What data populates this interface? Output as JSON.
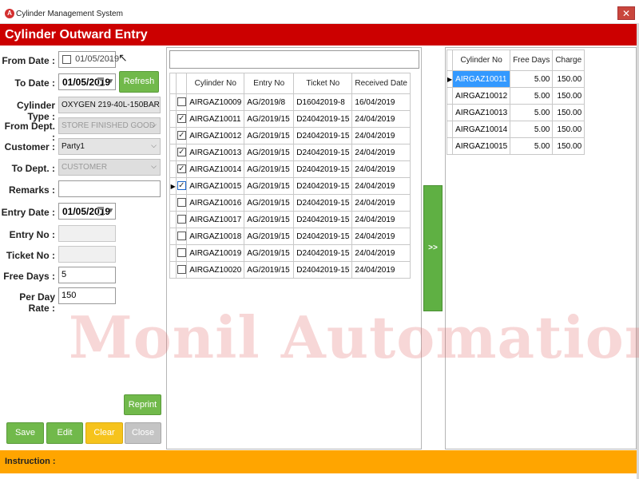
{
  "window": {
    "app_icon": "A",
    "title": "Cylinder Management System",
    "close_symbol": "✕"
  },
  "header": {
    "title": "Cylinder Outward Entry"
  },
  "form": {
    "from_date_label": "From Date :",
    "from_date_value": "01/05/2019",
    "to_date_label": "To Date :",
    "to_date_value": "01/05/2019",
    "refresh_label": "Refresh",
    "cylinder_type_label": "Cylinder Type :",
    "cylinder_type_value": "OXYGEN 219-40L-150BAR",
    "from_dept_label": "From Dept. :",
    "from_dept_value": "STORE FINISHED GOOD",
    "customer_label": "Customer :",
    "customer_value": "Party1",
    "to_dept_label": "To Dept. :",
    "to_dept_value": "CUSTOMER",
    "remarks_label": "Remarks :",
    "remarks_value": "",
    "entry_date_label": "Entry Date :",
    "entry_date_value": "01/05/2019",
    "entry_no_label": "Entry No :",
    "entry_no_value": "",
    "ticket_no_label": "Ticket No :",
    "ticket_no_value": "",
    "free_days_label": "Free Days :",
    "free_days_value": "5",
    "per_day_rate_label": "Per Day Rate :",
    "per_day_rate_value": "150"
  },
  "buttons": {
    "reprint": "Reprint",
    "save": "Save",
    "edit": "Edit",
    "clear": "Clear",
    "close": "Close",
    "move": ">>"
  },
  "search": {
    "value": ""
  },
  "left_grid": {
    "columns": [
      "Cylinder No",
      "Entry No",
      "Ticket No",
      "Received Date"
    ],
    "current_row_marker": "▶",
    "rows": [
      {
        "checked": false,
        "cylinder_no": "AIRGAZ10009",
        "entry_no": "AG/2019/8",
        "ticket_no": "D16042019-8",
        "received_date": "16/04/2019"
      },
      {
        "checked": true,
        "cylinder_no": "AIRGAZ10011",
        "entry_no": "AG/2019/15",
        "ticket_no": "D24042019-15",
        "received_date": "24/04/2019"
      },
      {
        "checked": true,
        "cylinder_no": "AIRGAZ10012",
        "entry_no": "AG/2019/15",
        "ticket_no": "D24042019-15",
        "received_date": "24/04/2019"
      },
      {
        "checked": true,
        "cylinder_no": "AIRGAZ10013",
        "entry_no": "AG/2019/15",
        "ticket_no": "D24042019-15",
        "received_date": "24/04/2019"
      },
      {
        "checked": true,
        "cylinder_no": "AIRGAZ10014",
        "entry_no": "AG/2019/15",
        "ticket_no": "D24042019-15",
        "received_date": "24/04/2019"
      },
      {
        "checked": true,
        "current": true,
        "cylinder_no": "AIRGAZ10015",
        "entry_no": "AG/2019/15",
        "ticket_no": "D24042019-15",
        "received_date": "24/04/2019"
      },
      {
        "checked": false,
        "cylinder_no": "AIRGAZ10016",
        "entry_no": "AG/2019/15",
        "ticket_no": "D24042019-15",
        "received_date": "24/04/2019"
      },
      {
        "checked": false,
        "cylinder_no": "AIRGAZ10017",
        "entry_no": "AG/2019/15",
        "ticket_no": "D24042019-15",
        "received_date": "24/04/2019"
      },
      {
        "checked": false,
        "cylinder_no": "AIRGAZ10018",
        "entry_no": "AG/2019/15",
        "ticket_no": "D24042019-15",
        "received_date": "24/04/2019"
      },
      {
        "checked": false,
        "cylinder_no": "AIRGAZ10019",
        "entry_no": "AG/2019/15",
        "ticket_no": "D24042019-15",
        "received_date": "24/04/2019"
      },
      {
        "checked": false,
        "cylinder_no": "AIRGAZ10020",
        "entry_no": "AG/2019/15",
        "ticket_no": "D24042019-15",
        "received_date": "24/04/2019"
      }
    ]
  },
  "right_grid": {
    "columns": [
      "Cylinder No",
      "Free Days",
      "Charge"
    ],
    "current_row_marker": "▶",
    "rows": [
      {
        "cylinder_no": "AIRGAZ10011",
        "free_days": "5.00",
        "charge": "150.00"
      },
      {
        "cylinder_no": "AIRGAZ10012",
        "free_days": "5.00",
        "charge": "150.00"
      },
      {
        "cylinder_no": "AIRGAZ10013",
        "free_days": "5.00",
        "charge": "150.00"
      },
      {
        "cylinder_no": "AIRGAZ10014",
        "free_days": "5.00",
        "charge": "150.00"
      },
      {
        "cylinder_no": "AIRGAZ10015",
        "free_days": "5.00",
        "charge": "150.00"
      }
    ]
  },
  "watermark": "Monil Automation",
  "instruction": {
    "label": "Instruction :"
  },
  "colors": {
    "header": "#cc0000",
    "instruction_bar": "#ffa500",
    "button_green": "#71b94b",
    "button_yellow": "#f6c31c",
    "button_gray": "#c4c4c4",
    "selection": "#3399ff"
  }
}
